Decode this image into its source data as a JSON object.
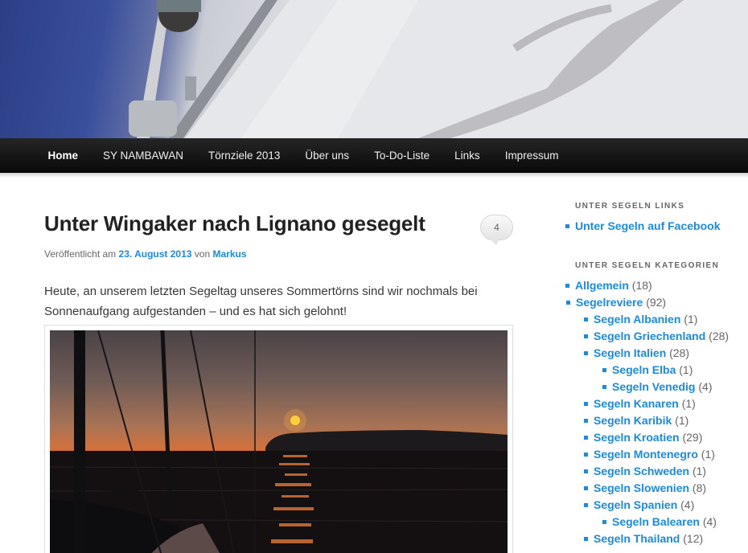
{
  "nav": {
    "items": [
      {
        "label": "Home",
        "active": true
      },
      {
        "label": "SY NAMBAWAN"
      },
      {
        "label": "Törnziele 2013"
      },
      {
        "label": "Über uns"
      },
      {
        "label": "To-Do-Liste"
      },
      {
        "label": "Links"
      },
      {
        "label": "Impressum"
      }
    ]
  },
  "post": {
    "title": "Unter Wingaker nach Lignano gesegelt",
    "comments": "4",
    "meta_prefix": "Veröffentlicht am",
    "date": "23. August 2013",
    "meta_by": "von",
    "author": "Markus",
    "text": "Heute, an unserem letzten Segeltag unseres Sommertörns sind wir nochmals bei Sonnenaufgang aufgestanden – und es hat sich gelohnt!"
  },
  "sidebar": {
    "links_title": "UNTER SEGELN LINKS",
    "links": [
      {
        "label": "Unter Segeln auf Facebook"
      }
    ],
    "categories_title": "UNTER SEGELN KATEGORIEN",
    "categories": [
      {
        "label": "Allgemein",
        "count": "(18)",
        "level": 0
      },
      {
        "label": "Segelreviere",
        "count": "(92)",
        "level": 0
      },
      {
        "label": "Segeln Albanien",
        "count": "(1)",
        "level": 1
      },
      {
        "label": "Segeln Griechenland",
        "count": "(28)",
        "level": 1
      },
      {
        "label": "Segeln Italien",
        "count": "(28)",
        "level": 1
      },
      {
        "label": "Segeln Elba",
        "count": "(1)",
        "level": 2
      },
      {
        "label": "Segeln Venedig",
        "count": "(4)",
        "level": 2
      },
      {
        "label": "Segeln Kanaren",
        "count": "(1)",
        "level": 1
      },
      {
        "label": "Segeln Karibik",
        "count": "(1)",
        "level": 1
      },
      {
        "label": "Segeln Kroatien",
        "count": "(29)",
        "level": 1
      },
      {
        "label": "Segeln Montenegro",
        "count": "(1)",
        "level": 1
      },
      {
        "label": "Segeln Schweden",
        "count": "(1)",
        "level": 1
      },
      {
        "label": "Segeln Slowenien",
        "count": "(8)",
        "level": 1
      },
      {
        "label": "Segeln Spanien",
        "count": "(4)",
        "level": 1
      },
      {
        "label": "Segeln Balearen",
        "count": "(4)",
        "level": 2
      },
      {
        "label": "Segeln Thailand",
        "count": "(12)",
        "level": 1
      }
    ]
  },
  "colors": {
    "link": "#1b8be0",
    "nav_bg": "#111111"
  }
}
